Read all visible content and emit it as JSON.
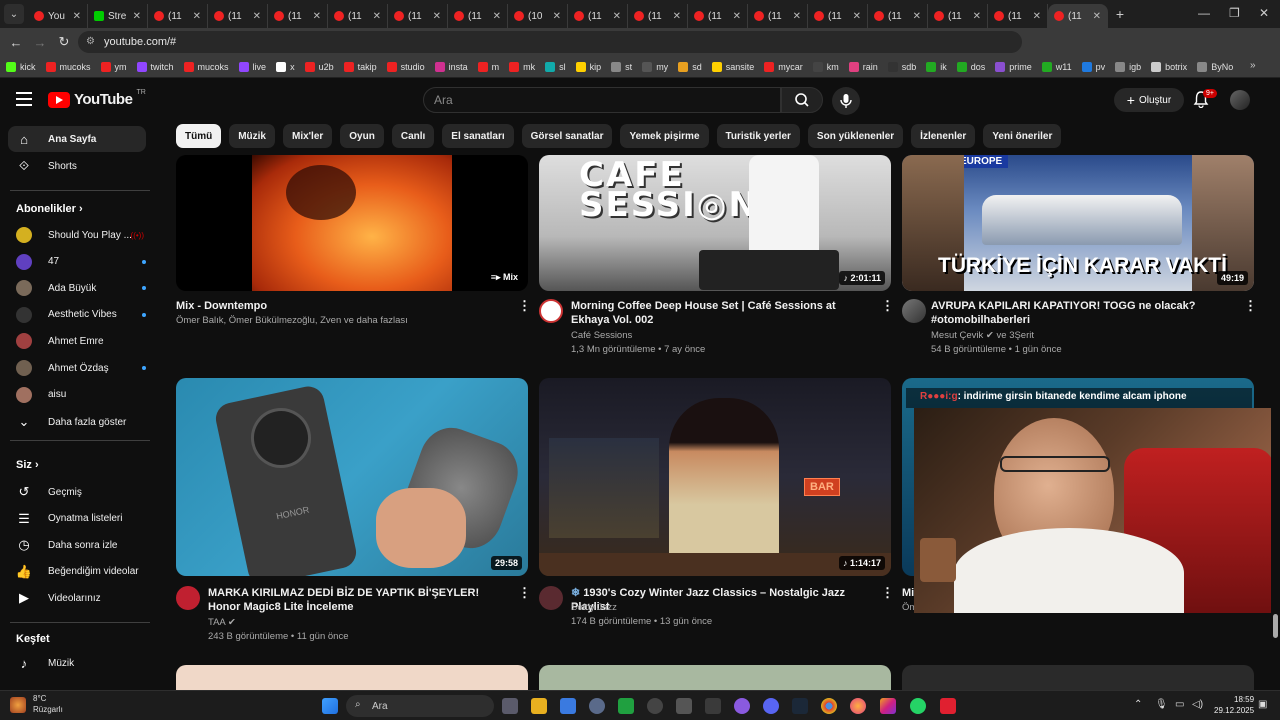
{
  "browser": {
    "tabs": [
      {
        "label": "You",
        "icon": "youtube-favicon"
      },
      {
        "label": "Stre",
        "icon": "kick-favicon"
      },
      {
        "label": "(11",
        "icon": "youtube-favicon"
      },
      {
        "label": "(11",
        "icon": "youtube-favicon"
      },
      {
        "label": "(11",
        "icon": "youtube-favicon"
      },
      {
        "label": "(11",
        "icon": "youtube-favicon"
      },
      {
        "label": "(11",
        "icon": "youtube-favicon"
      },
      {
        "label": "(11",
        "icon": "youtube-favicon"
      },
      {
        "label": "(10",
        "icon": "youtube-favicon"
      },
      {
        "label": "(11",
        "icon": "youtube-favicon"
      },
      {
        "label": "(11",
        "icon": "youtube-favicon"
      },
      {
        "label": "(11",
        "icon": "youtube-favicon"
      },
      {
        "label": "(11",
        "icon": "youtube-favicon"
      },
      {
        "label": "(11",
        "icon": "youtube-favicon"
      },
      {
        "label": "(11",
        "icon": "youtube-favicon"
      },
      {
        "label": "(11",
        "icon": "youtube-favicon"
      },
      {
        "label": "(11",
        "icon": "youtube-favicon"
      },
      {
        "label": "(11",
        "icon": "youtube-favicon"
      }
    ],
    "url": "youtube.com/#",
    "bookmarks": [
      "kick",
      "mucoks",
      "ym",
      "twitch",
      "mucoks",
      "live",
      "x",
      "u2b",
      "takip",
      "studio",
      "insta",
      "m",
      "mk",
      "sl",
      "kip",
      "st",
      "my",
      "sd",
      "sansite",
      "mycar",
      "km",
      "rain",
      "sdb",
      "ik",
      "dos",
      "prime",
      "w11",
      "pv",
      "igb",
      "botrix",
      "ByNo"
    ]
  },
  "header": {
    "logo_text": "YouTube",
    "country": "TR",
    "search_placeholder": "Ara",
    "create_label": "Oluştur",
    "notifications_badge": "9+"
  },
  "chips": [
    "Tümü",
    "Müzik",
    "Mix'ler",
    "Oyun",
    "Canlı",
    "El sanatları",
    "Görsel sanatlar",
    "Yemek pişirme",
    "Turistik yerler",
    "Son yüklenenler",
    "İzlenenler",
    "Yeni öneriler"
  ],
  "sidebar": {
    "main": [
      {
        "label": "Ana Sayfa",
        "icon": "home-icon"
      },
      {
        "label": "Shorts",
        "icon": "shorts-icon"
      }
    ],
    "subscriptions_title": "Abonelikler",
    "subscriptions": [
      {
        "label": "Should You Play ...",
        "live": true,
        "color": "#d4b020"
      },
      {
        "label": "47",
        "new": true,
        "color": "#6040c0"
      },
      {
        "label": "Ada Büyük",
        "new": true,
        "color": "#7a6a5a"
      },
      {
        "label": "Aesthetic Vibes",
        "new": true,
        "color": "#333333"
      },
      {
        "label": "Ahmet Emre",
        "new": false,
        "color": "#a04040"
      },
      {
        "label": "Ahmet Özdaş",
        "new": true,
        "color": "#706050"
      },
      {
        "label": "aisu",
        "new": false,
        "color": "#a07060"
      }
    ],
    "show_more": "Daha fazla göster",
    "you_title": "Siz",
    "you_items": [
      {
        "label": "Geçmiş",
        "icon": "history-icon"
      },
      {
        "label": "Oynatma listeleri",
        "icon": "playlist-icon"
      },
      {
        "label": "Daha sonra izle",
        "icon": "clock-icon"
      },
      {
        "label": "Beğendiğim videolar",
        "icon": "thumbs-up-icon"
      },
      {
        "label": "Videolarınız",
        "icon": "video-icon"
      }
    ],
    "explore_title": "Keşfet",
    "explore_items": [
      {
        "label": "Müzik",
        "icon": "music-note-icon"
      }
    ]
  },
  "videos": [
    {
      "title": "Mix - Downtempo",
      "channel": "Ömer Balık, Ömer Bükülmezoğlu, Zven ve daha fazlası",
      "stats": "",
      "badge": "Mix"
    },
    {
      "title": "Morning Coffee Deep House Set | Café Sessions at Ekhaya Vol. 002",
      "channel": "Café Sessions",
      "stats": "1,3 Mn görüntüleme • 7 ay önce",
      "duration": "2:01:11"
    },
    {
      "title": "AVRUPA KAPILARI KAPATIYOR! TOGG ne olacak? #otomobilhaberleri",
      "channel": "Mesut Çevik",
      "channel_extra": "ve 3Şerit",
      "stats": "54 B görüntüleme • 1 gün önce",
      "duration": "49:19",
      "thumb_text": "TÜRKİYE İÇİN KARAR VAKTİ",
      "thumb_tag": "EUROPE"
    },
    {
      "title": "MARKA KIRILMAZ DEDİ BİZ DE YAPTIK Bİ'ŞEYLER!  Honor Magic8 Lite İnceleme",
      "channel": "TAA",
      "stats": "243 B görüntüleme • 11 gün önce",
      "duration": "29:58",
      "thumb_text": "HONOR"
    },
    {
      "title": "1930's Cozy Winter Jazz Classics – Nostalgic Jazz Playlist",
      "channel": "Softly Jazz",
      "stats": "174 B görüntüleme • 13 gün önce",
      "duration": "1:14:17",
      "thumb_text": "BAR"
    },
    {
      "title": "Mi",
      "channel": "Öm",
      "stats": ""
    }
  ],
  "stream_chat": ": indirime girsin bitanede kendime alcam iphone",
  "taskbar": {
    "temperature": "8°C",
    "weather": "Rüzgarlı",
    "search": "Ara",
    "time": "18:59",
    "date": "29.12.2025"
  }
}
